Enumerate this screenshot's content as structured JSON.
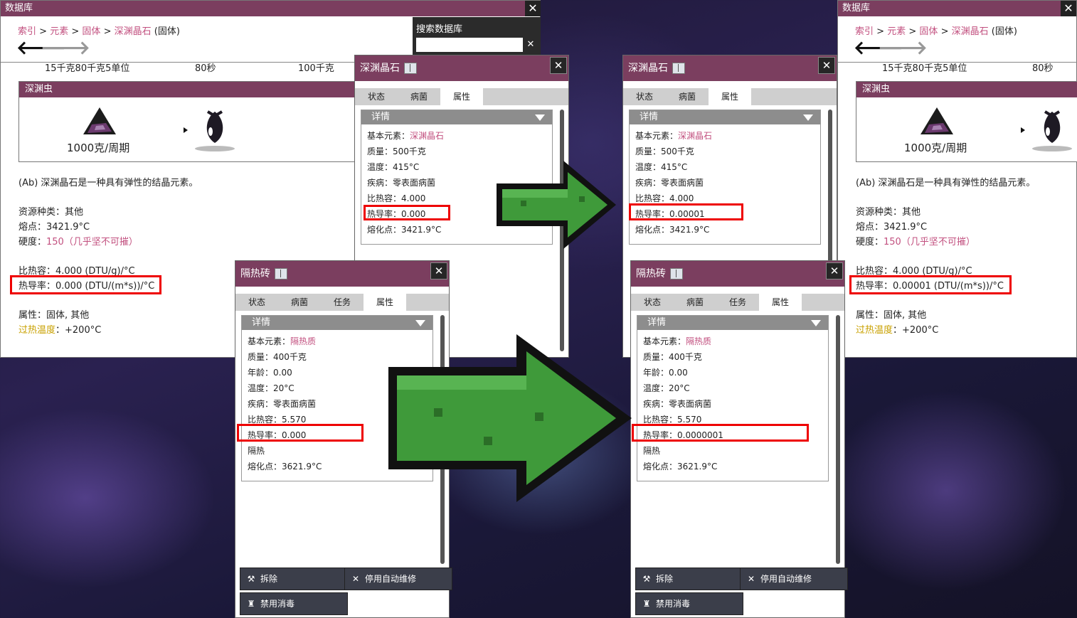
{
  "database": {
    "title": "数据库",
    "close": "✕",
    "breadcrumb": {
      "index": "索引",
      "elements": "元素",
      "solid": "固体",
      "item": "深渊晶石",
      "suffix": "(固体)",
      "sep": ">"
    },
    "back_arrow": "🡐",
    "forward_arrow": "🡒",
    "partial_row": {
      "a": "15千克80千克5单位",
      "b": "80秒",
      "c": "100千克"
    },
    "critter": {
      "header": "深渊虫",
      "rate": "1000克/周期"
    },
    "description": "(Ab) 深渊晶石是一种具有弹性的结晶元素。",
    "resource_type": "资源种类：其他",
    "melting_point": "熔点：3421.9°C",
    "hardness_label": "硬度：",
    "hardness_value": "150（几乎坚不可摧）",
    "shc": "比热容：4.000 (DTU/g)/°C",
    "tc_before": "热导率：0.000 (DTU/(m*s))/°C",
    "tc_after": "热导率：0.00001 (DTU/(m*s))/°C",
    "attributes": "属性：固体, 其他",
    "overheat_label": "过热温度",
    "overheat_value": "：+200°C"
  },
  "search": {
    "label": "搜索数据库",
    "value": "",
    "clear": "✕"
  },
  "abyss_panel": {
    "title": "深渊晶石",
    "close": "✕",
    "tabs": [
      "状态",
      "病菌",
      "属性"
    ],
    "details": "详情",
    "base_label": "基本元素：",
    "base_value": "深渊晶石",
    "mass": "质量：500千克",
    "temp": "温度：415°C",
    "disease": "疾病：零表面病菌",
    "shc": "比热容：4.000",
    "tc_before": "热导率：0.000",
    "tc_after": "热导率：0.00001",
    "melt": "熔化点：3421.9°C"
  },
  "brick_panel": {
    "title": "隔热砖",
    "close": "✕",
    "tabs": [
      "状态",
      "病菌",
      "任务",
      "属性"
    ],
    "details": "详情",
    "base_label": "基本元素：",
    "base_value": "隔热质",
    "mass": "质量：400千克",
    "age": "年龄：0.00",
    "temp": "温度：20°C",
    "disease": "疾病：零表面病菌",
    "shc": "比热容：5.570",
    "tc_before": "热导率：0.000",
    "tc_after": "热导率：0.0000001",
    "insulated": "隔热",
    "melt": "熔化点：3621.9°C",
    "buttons": {
      "deconstruct": "拆除",
      "auto_repair": "停用自动维修",
      "disinfect": "禁用消毒"
    }
  },
  "colors": {
    "title_bar": "#7b3e5f",
    "highlight": "#e00000",
    "arrow_green": "#3f9a3a",
    "link_pink": "#c2507f",
    "overheat_gold": "#c9a100"
  }
}
